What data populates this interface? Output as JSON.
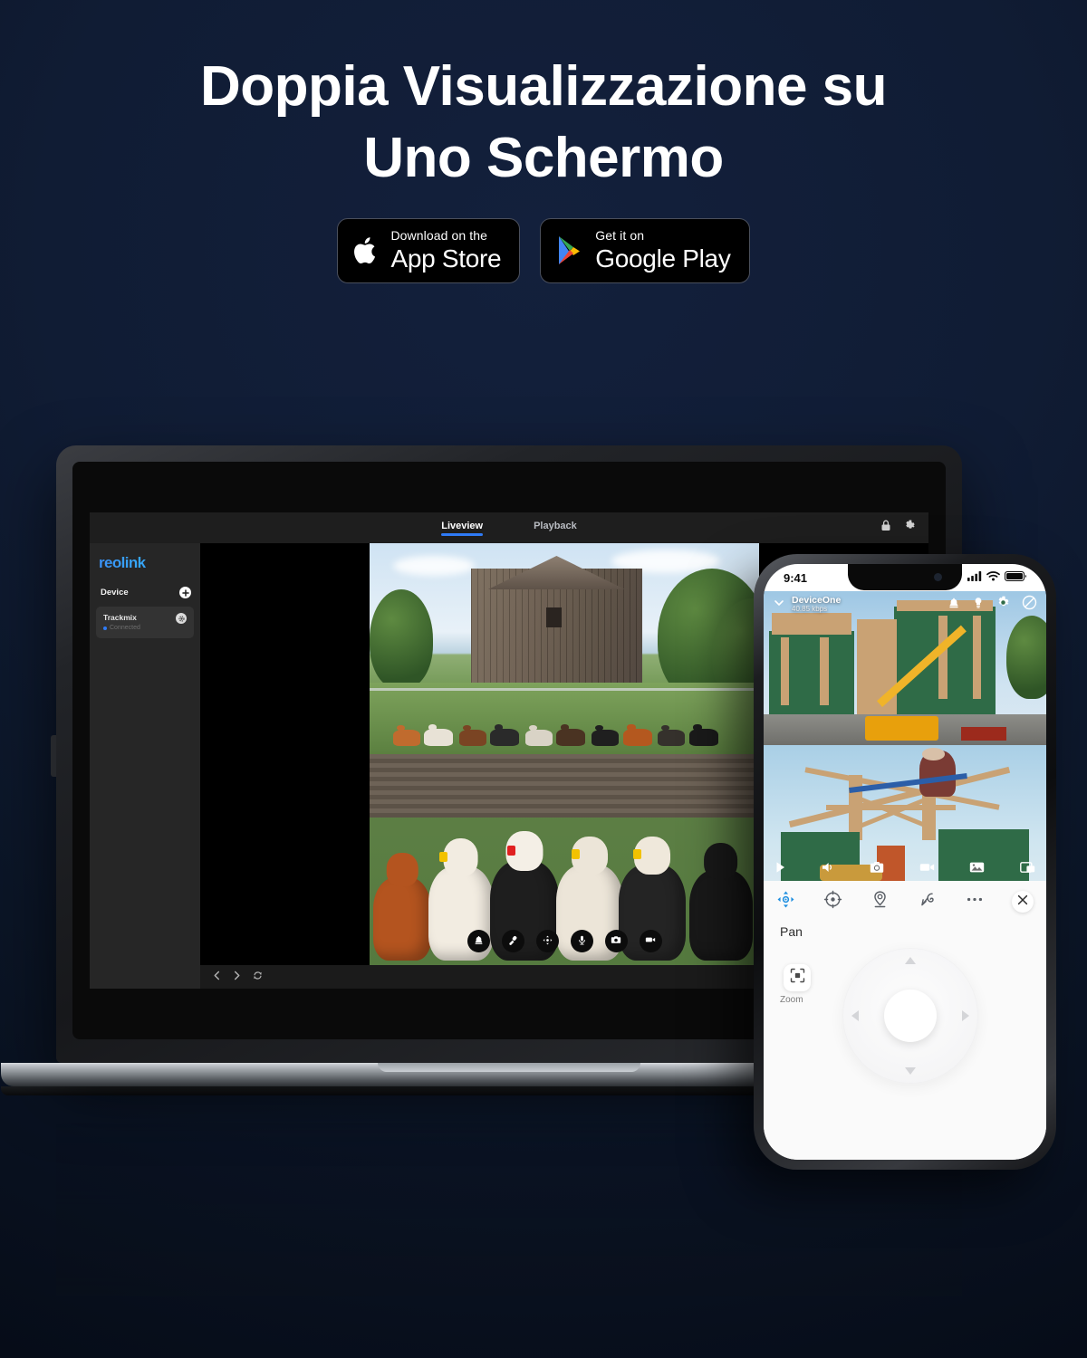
{
  "hero": {
    "title_line1": "Doppia Visualizzazione su",
    "title_line2": "Uno Schermo",
    "badges": [
      {
        "id": "app-store",
        "small": "Download on the",
        "big": "App Store",
        "icon": "apple-icon"
      },
      {
        "id": "google-play",
        "small": "Get it on",
        "big": "Google Play",
        "icon": "google-play-icon"
      }
    ]
  },
  "desktop_app": {
    "brand": "reolink",
    "tabs": [
      {
        "label": "Liveview",
        "active": true
      },
      {
        "label": "Playback",
        "active": false
      }
    ],
    "top_right_icons": [
      "lock-icon",
      "gear-icon"
    ],
    "sidebar": {
      "section_title": "Device",
      "add_icon": "plus-icon",
      "items": [
        {
          "name": "Trackmix",
          "status": "Connected",
          "gear_icon": "gear-icon"
        }
      ]
    },
    "video_controls": [
      "siren-icon",
      "spotlight-icon",
      "ptz-move-icon",
      "microphone-icon",
      "snapshot-icon",
      "record-icon"
    ],
    "footer_controls": [
      "prev-icon",
      "next-icon",
      "refresh-icon"
    ],
    "views": [
      {
        "id": "barn-view",
        "description": "Cattle herd in front of weathered wooden barn"
      },
      {
        "id": "pen-view",
        "description": "Close up of dairy cows with ear tags in a pen"
      }
    ]
  },
  "phone_app": {
    "status_bar": {
      "time": "9:41",
      "icons": [
        "cellular-signal-icon",
        "wifi-icon",
        "battery-icon"
      ]
    },
    "camera_header": {
      "collapse_icon": "chevron-down-icon",
      "device_name": "DeviceOne",
      "bitrate": "40.85 kbps",
      "icons": [
        "siren-icon",
        "spotlight-icon",
        "gear-icon",
        "privacy-mask-icon"
      ]
    },
    "camera_toolbar": [
      "play-icon",
      "speaker-icon",
      "snapshot-icon",
      "record-icon",
      "gallery-icon",
      "pip-icon"
    ],
    "views": [
      {
        "id": "construction-view",
        "description": "Multi-storey timber frame house with green sheathing and yellow telehandler"
      },
      {
        "id": "roof-view",
        "description": "Worker installing rafters on a timber frame roof"
      }
    ],
    "ptz": {
      "tabs": [
        {
          "icon": "pan-icon",
          "active": true
        },
        {
          "icon": "calibrate-icon",
          "active": false
        },
        {
          "icon": "preset-marker-icon",
          "active": false
        },
        {
          "icon": "guard-track-icon",
          "active": false
        },
        {
          "icon": "more-icon",
          "active": false
        }
      ],
      "close_icon": "close-icon",
      "label": "Pan",
      "zoom_button": {
        "icon": "zoom-frame-icon",
        "label": "Zoom"
      },
      "dpad": {
        "up": "arrow-up",
        "down": "arrow-down",
        "left": "arrow-left",
        "right": "arrow-right",
        "center": "dpad-center-button"
      }
    }
  },
  "colors": {
    "background": "#101c34",
    "accent_blue": "#2f7bf6",
    "brand_blue": "#3b8cf7",
    "text_white": "#ffffff",
    "sidebar": "#262626",
    "panel": "#1b1b1b"
  }
}
